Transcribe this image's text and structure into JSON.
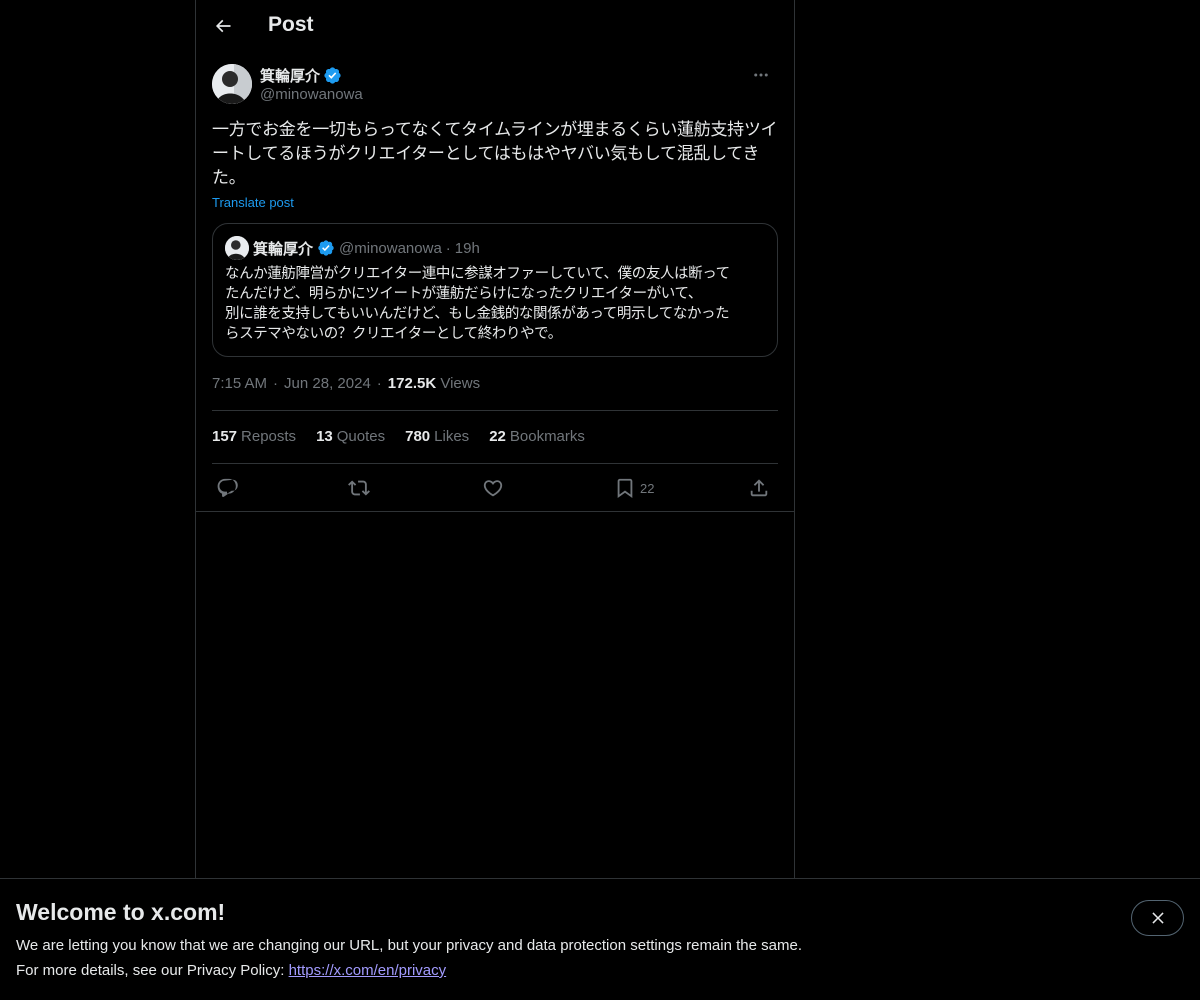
{
  "header": {
    "title": "Post"
  },
  "author": {
    "name": "箕輪厚介",
    "handle": "@minowanowa"
  },
  "post": {
    "text": "一方でお金を一切もらってなくてタイムラインが埋まるくらい蓮舫支持ツイートしてるほうがクリエイターとしてはもはやヤバい気もして混乱してきた。",
    "translate_label": "Translate post"
  },
  "quote": {
    "name": "箕輪厚介",
    "handle": "@minowanowa",
    "separator": "·",
    "time": "19h",
    "lines": [
      "なんか蓮舫陣営がクリエイター連中に参謀オファーしていて、僕の友人は断って",
      "たんだけど、明らかにツイートが蓮舫だらけになったクリエイターがいて、",
      "別に誰を支持してもいいんだけど、もし金銭的な関係があって明示してなかった",
      "らステマやないの？クリエイターとして終わりやで。"
    ]
  },
  "meta": {
    "time": "7:15 AM",
    "separator": "·",
    "date": "Jun 28, 2024",
    "views_count": "172.5K",
    "views_label": "Views"
  },
  "stats": [
    {
      "count": "157",
      "label": "Reposts"
    },
    {
      "count": "13",
      "label": "Quotes"
    },
    {
      "count": "780",
      "label": "Likes"
    },
    {
      "count": "22",
      "label": "Bookmarks"
    }
  ],
  "actions": {
    "bookmark_count": "22"
  },
  "icons": {
    "back": "arrow-left-icon",
    "verified": "verified-badge-icon",
    "more": "more-horizontal-icon",
    "reply": "reply-icon",
    "repost": "repost-icon",
    "like": "heart-icon",
    "bookmark": "bookmark-icon",
    "share": "share-icon",
    "close": "close-icon"
  },
  "colors": {
    "background": "#000000",
    "text": "#e7e9ea",
    "muted": "#71767b",
    "accent": "#1d9bf0",
    "border": "#2f3336"
  },
  "banner": {
    "title": "Welcome to x.com!",
    "line1": "We are letting you know that we are changing our URL, but your privacy and data protection settings remain the same.",
    "line2_prefix": "For more details, see our Privacy Policy: ",
    "link": "https://x.com/en/privacy"
  }
}
